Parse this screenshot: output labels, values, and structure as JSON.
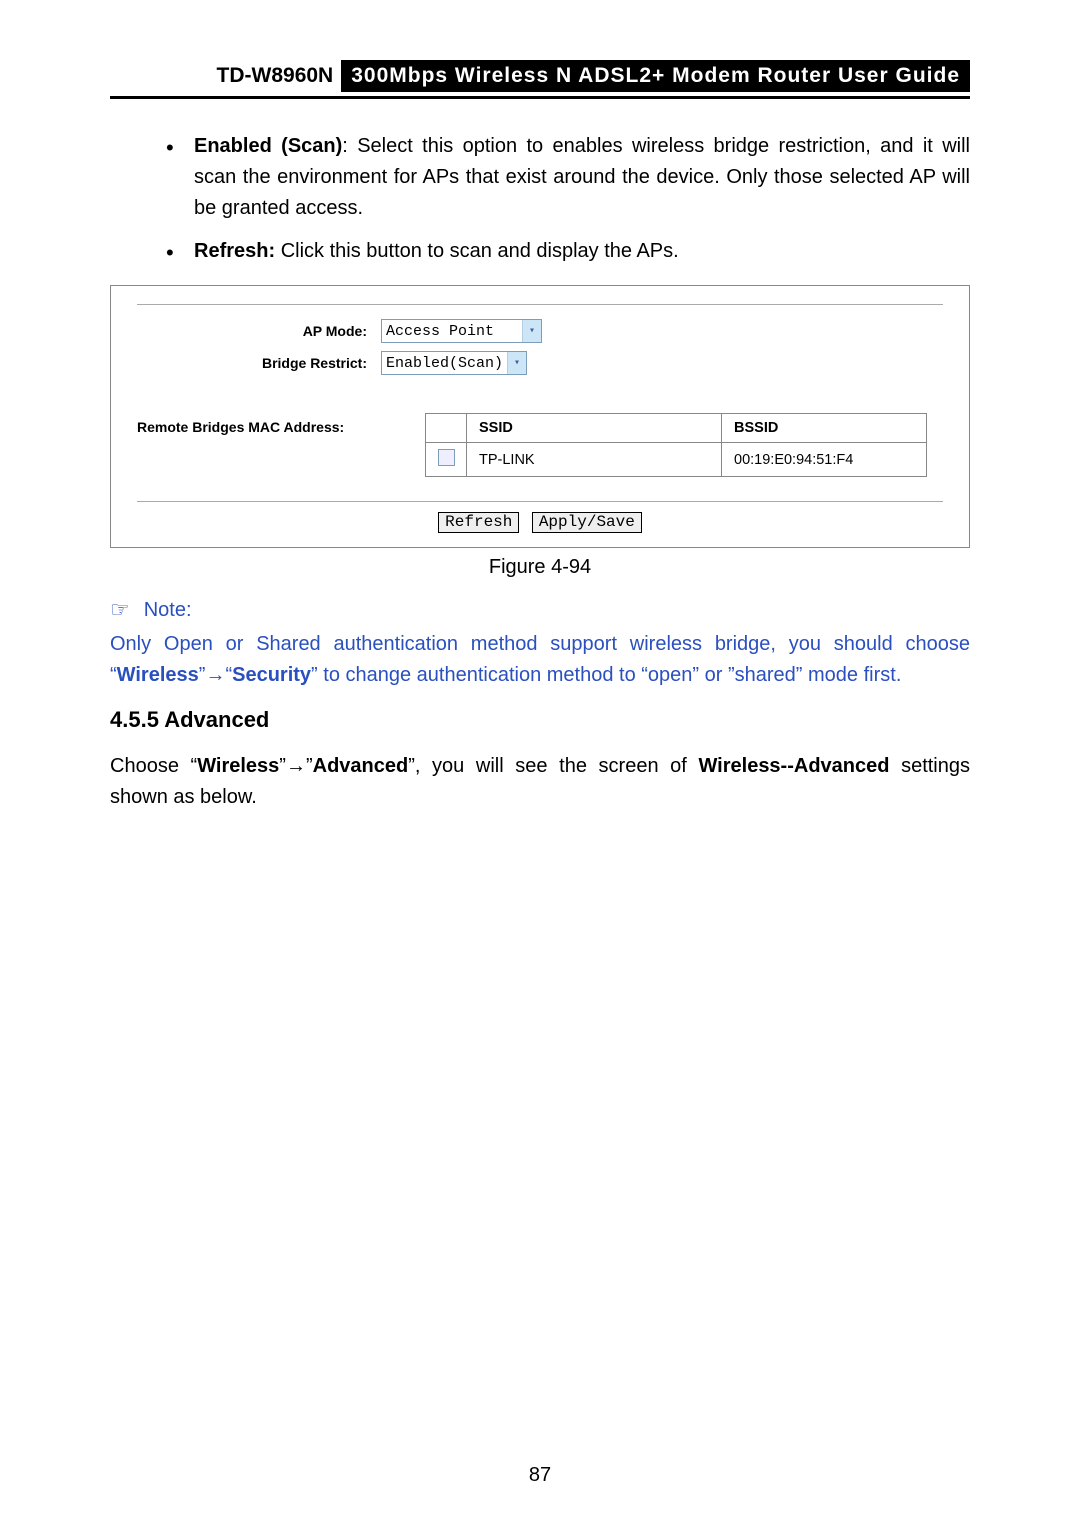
{
  "header": {
    "model": "TD-W8960N",
    "title": "300Mbps Wireless N ADSL2+ Modem Router User Guide"
  },
  "bullets": {
    "enabled_scan_label": "Enabled (Scan)",
    "enabled_scan_text": ": Select this option to enables wireless bridge restriction, and it will scan the environment for APs that exist around the device. Only those selected AP will be granted access.",
    "refresh_label": "Refresh:",
    "refresh_text": " Click this button to scan and display the APs."
  },
  "screenshot": {
    "labels": {
      "ap_mode": "AP Mode:",
      "bridge_restrict": "Bridge Restrict:",
      "remote_bridges": "Remote Bridges MAC Address:"
    },
    "selects": {
      "ap_mode_value": "Access Point",
      "bridge_restrict_value": "Enabled(Scan)"
    },
    "table": {
      "header_ssid": "SSID",
      "header_bssid": "BSSID",
      "row1_ssid": "TP-LINK",
      "row1_bssid": "00:19:E0:94:51:F4"
    },
    "buttons": {
      "refresh": "Refresh",
      "apply_save": "Apply/Save"
    }
  },
  "figure_caption": "Figure 4-94",
  "note": {
    "hand": "☞",
    "label": "Note:",
    "line1_a": "Only Open or Shared authentication method support wireless bridge, you should choose “",
    "wireless": "Wireless",
    "arrow": "→",
    "security": "Security",
    "line1_b": "” to change authentication method to “open” or ”shared” mode first."
  },
  "section": {
    "number_title": "4.5.5   Advanced"
  },
  "para": {
    "pre": "Choose “",
    "w1": "Wireless",
    "arrow": "→",
    "w2": "Advanced",
    "mid": "”, you will see the screen of ",
    "w3": "Wireless--Advanced",
    "post": " settings shown as below."
  },
  "page_number": "87"
}
